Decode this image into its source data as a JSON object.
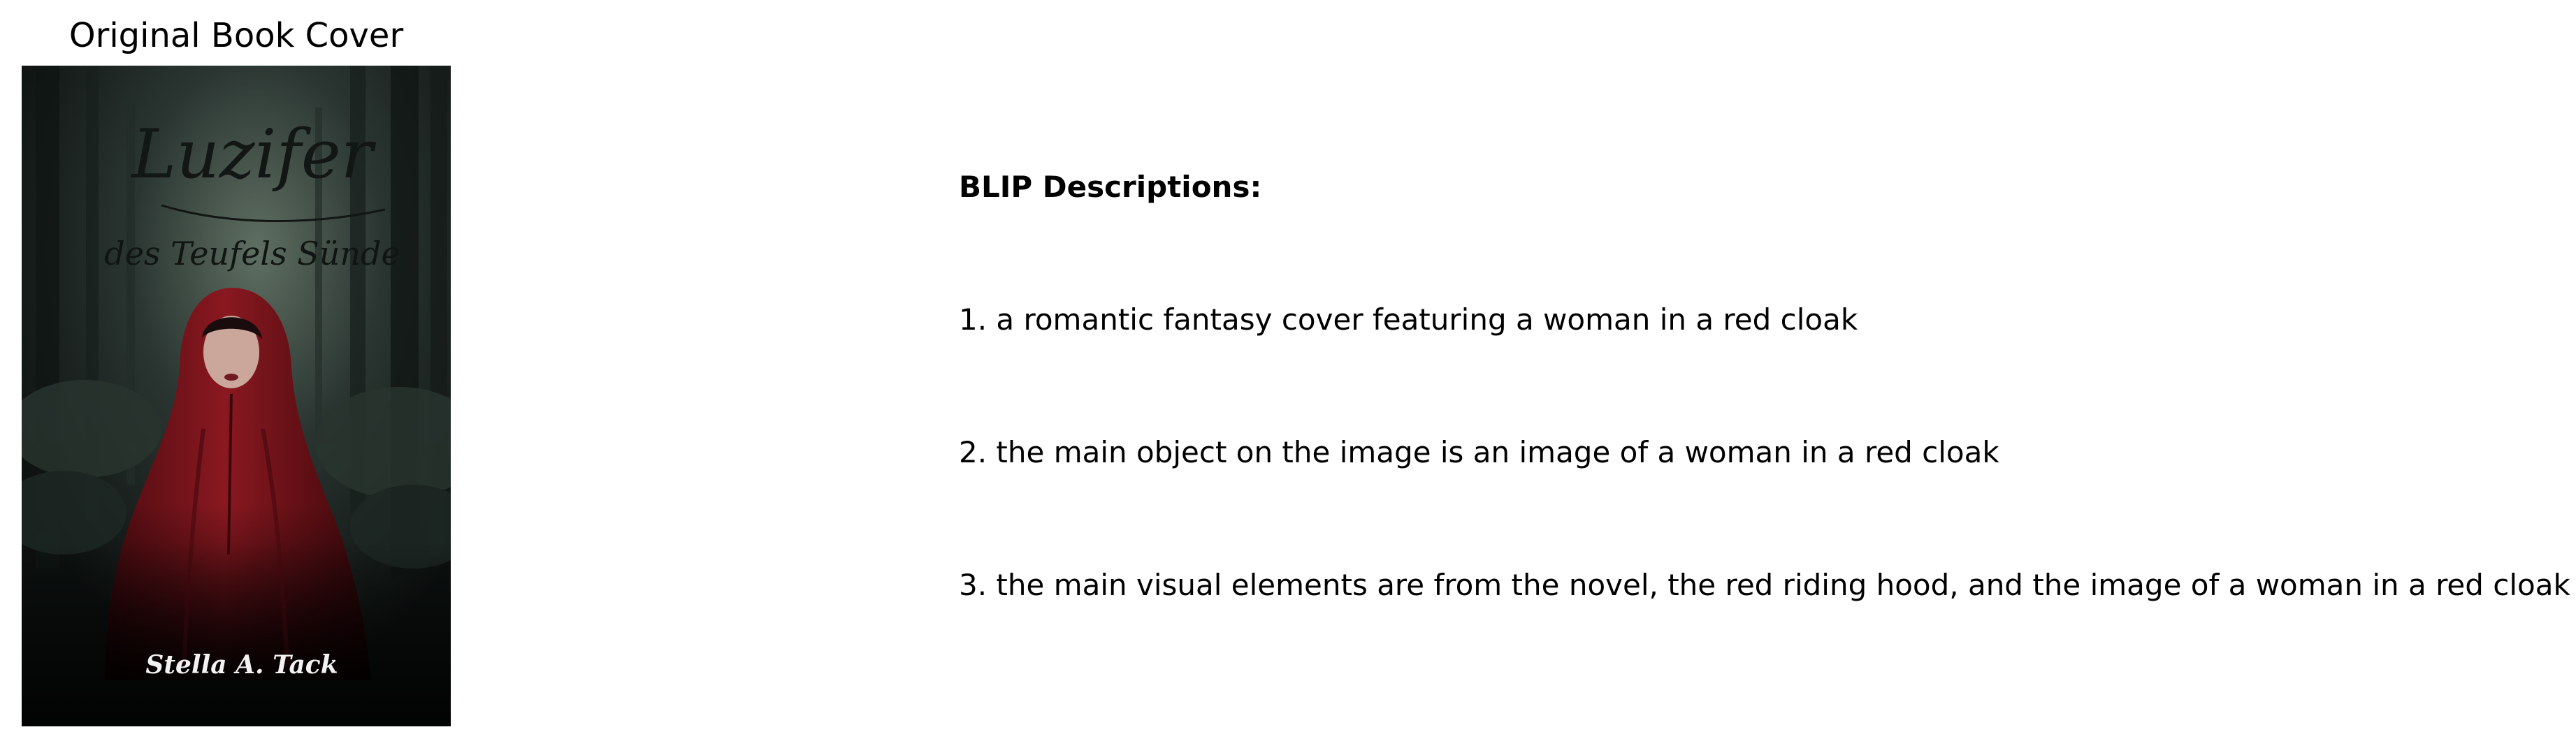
{
  "cover_panel": {
    "title": "Original Book Cover",
    "book_title": "Luzifer",
    "book_subtitle": "des Teufels Sünde",
    "book_author": "Stella A. Tack",
    "colors": {
      "background": "#1b2422",
      "cloak": "#7a141a",
      "text_dark": "#121614",
      "text_light": "#f2f2f2"
    }
  },
  "descriptions": {
    "heading": "BLIP Descriptions:",
    "items": [
      "1. a romantic fantasy cover featuring a woman in a red cloak",
      "2. the main object on the image is an image of a woman in a red cloak",
      "3. the main visual elements are from the novel, the red riding hood, and the image of a woman in a red cloak"
    ]
  }
}
